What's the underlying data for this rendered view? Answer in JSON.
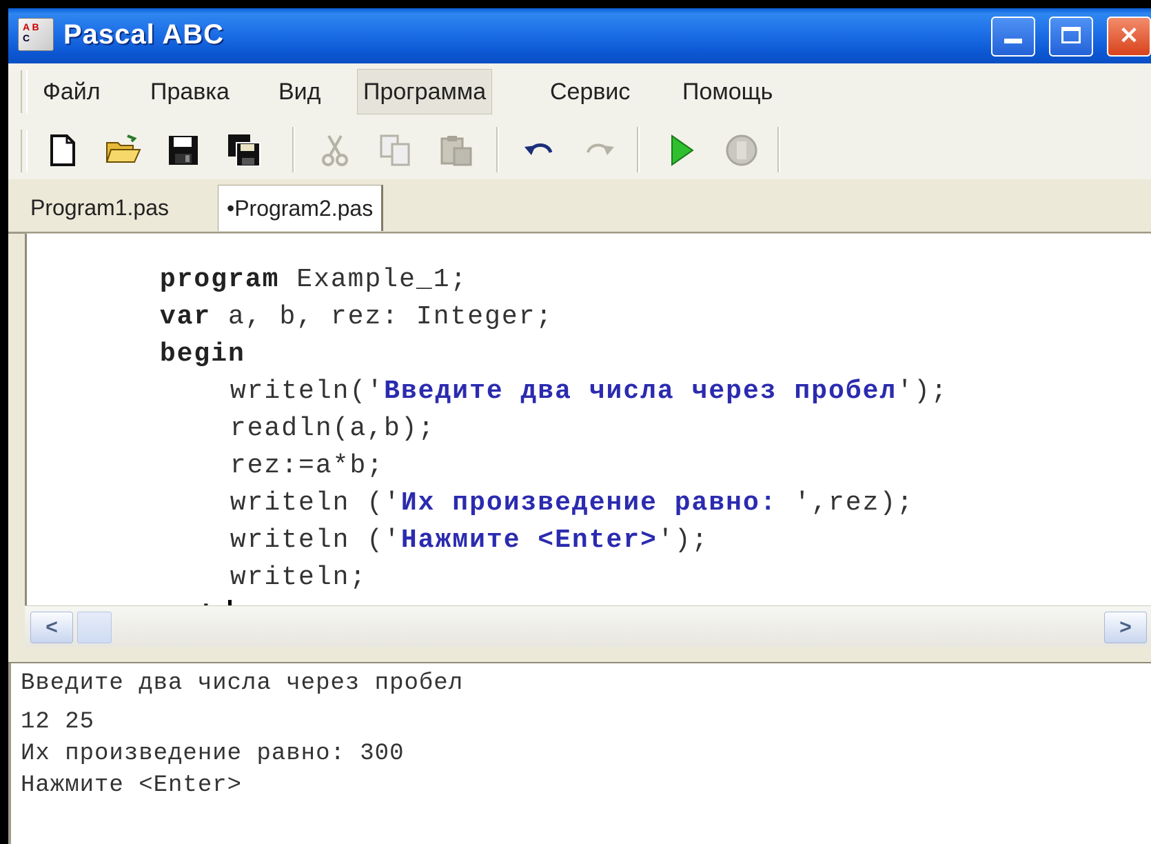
{
  "window": {
    "title": "Pascal ABC",
    "icon_text_top": "A B",
    "icon_text_bottom": "C"
  },
  "menu": {
    "items": [
      "Файл",
      "Правка",
      "Вид",
      "Программа",
      "Сервис",
      "Помощь"
    ]
  },
  "toolbar": {
    "icons": [
      "new-file-icon",
      "open-folder-icon",
      "save-icon",
      "save-all-icon",
      "cut-icon",
      "copy-icon",
      "paste-icon",
      "undo-icon",
      "redo-icon",
      "run-icon",
      "stop-icon"
    ]
  },
  "tabs": [
    {
      "label": "Program1.pas"
    },
    {
      "label": "•Program2.pas"
    }
  ],
  "editor": {
    "lines": {
      "l1_kw": "program",
      "l1_rest": " Example_1;",
      "l2_kw": "var",
      "l2_rest": " a, b, rez: Integer;",
      "l3_kw": "begin",
      "l4_pre": "writeln('",
      "l4_str": "Введите два числа через пробел",
      "l4_post": "');",
      "l5": "readln(a,b);",
      "l6": "rez:=a*b;",
      "l7_pre": "writeln ('",
      "l7_str": "Их произведение равно: ",
      "l7_post": "',rez);",
      "l8_pre": "writeln ('",
      "l8_str": "Нажмите <Enter>",
      "l8_post": "');",
      "l9": "writeln;",
      "l10_kw": "end",
      "l10_rest": "."
    }
  },
  "output": {
    "lines": [
      "Введите два числа через пробел",
      "12 25",
      "Их произведение равно: 300",
      "Нажмите <Enter>"
    ]
  },
  "scrollbar": {
    "left_arrow": "<",
    "right_arrow": ">"
  }
}
